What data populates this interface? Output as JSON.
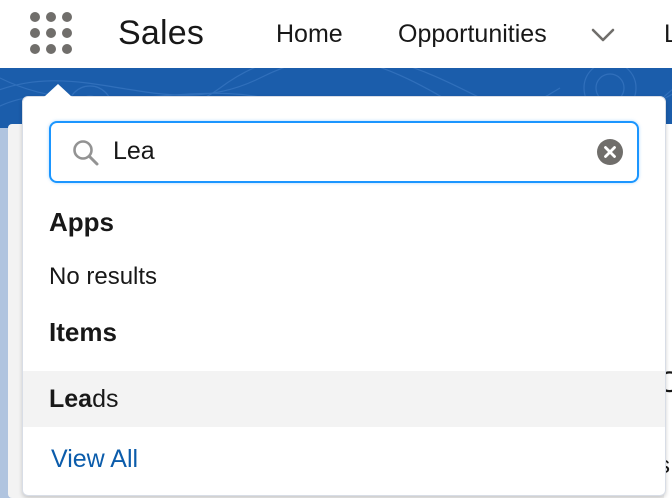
{
  "header": {
    "app_launcher_icon": "waffle-icon",
    "app_name": "Sales",
    "nav_items": [
      {
        "label": "Home"
      },
      {
        "label": "Opportunities"
      }
    ],
    "nav_more_icon": "chevron-down-icon",
    "nav_cut_label": "L"
  },
  "app_launcher": {
    "search": {
      "icon": "search-icon",
      "value": "Lea",
      "clear_icon": "clear-icon"
    },
    "apps_heading": "Apps",
    "apps_empty": "No results",
    "items_heading": "Items",
    "items": [
      {
        "match": "Lea",
        "rest": "ds"
      }
    ],
    "view_all_label": "View All"
  },
  "background": {
    "glyph_1": "O",
    "glyph_2": "s"
  },
  "colors": {
    "brand_band": "#1b5dab",
    "focus_border": "#1b96ff",
    "link": "#0b5cab",
    "hover_row": "#f3f3f3"
  }
}
